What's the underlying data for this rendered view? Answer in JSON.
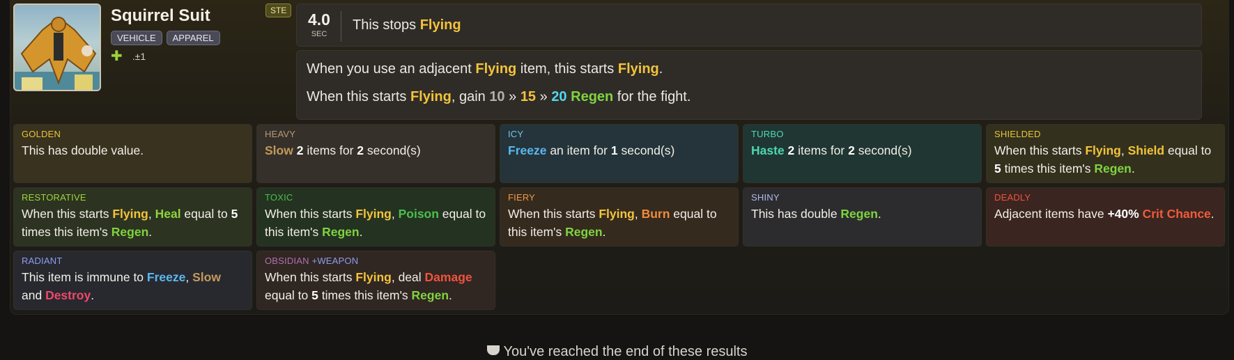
{
  "item": {
    "name": "Squirrel Suit",
    "tags": [
      "VEHICLE",
      "APPAREL"
    ],
    "enchant_count": ".±1",
    "badge": "STE"
  },
  "cooldown": {
    "value": "4.0",
    "unit": "SEC"
  },
  "abilities": {
    "top": {
      "pre": "This stops ",
      "kw": "Flying"
    },
    "line1": {
      "a": "When you use an adjacent ",
      "b": "Flying",
      "c": " item, this starts ",
      "d": "Flying",
      "e": "."
    },
    "line2": {
      "a": "When this starts ",
      "b": "Flying",
      "c": ", gain ",
      "v1": "10",
      "sep1": " » ",
      "v2": "15",
      "sep2": " » ",
      "v3": "20",
      "d": " ",
      "e": "Regen",
      "f": " for the fight."
    }
  },
  "enchantments": {
    "golden": {
      "title": "GOLDEN",
      "text": "This has double value."
    },
    "heavy": {
      "title": "HEAVY",
      "kw": "Slow",
      "a": " ",
      "n1": "2",
      "b": " items for ",
      "n2": "2",
      "c": " second(s)"
    },
    "icy": {
      "title": "ICY",
      "kw": "Freeze",
      "a": " an item for ",
      "n1": "1",
      "b": " second(s)"
    },
    "turbo": {
      "title": "TURBO",
      "kw": "Haste",
      "a": " ",
      "n1": "2",
      "b": " items for ",
      "n2": "2",
      "c": " second(s)"
    },
    "shielded": {
      "title": "SHIELDED",
      "a": "When this starts ",
      "fly": "Flying",
      "b": ", ",
      "kw": "Shield",
      "c": " equal to ",
      "n": "5",
      "d": " times this item's ",
      "regen": "Regen",
      "e": "."
    },
    "restorative": {
      "title": "RESTORATIVE",
      "a": "When this starts ",
      "fly": "Flying",
      "b": ", ",
      "kw": "Heal",
      "c": " equal to ",
      "n": "5",
      "d": " times this item's ",
      "regen": "Regen",
      "e": "."
    },
    "toxic": {
      "title": "TOXIC",
      "a": "When this starts ",
      "fly": "Flying",
      "b": ", ",
      "kw": "Poison",
      "c": " equal to this item's ",
      "regen": "Regen",
      "e": "."
    },
    "fiery": {
      "title": "FIERY",
      "a": "When this starts ",
      "fly": "Flying",
      "b": ", ",
      "kw": "Burn",
      "c": " equal to this item's ",
      "regen": "Regen",
      "e": "."
    },
    "shiny": {
      "title": "SHINY",
      "a": "This has double ",
      "regen": "Regen",
      "e": "."
    },
    "deadly": {
      "title": "DEADLY",
      "a": "Adjacent items have ",
      "n": "+40%",
      "b": " ",
      "kw": "Crit Chance",
      "e": "."
    },
    "radiant": {
      "title": "RADIANT",
      "a": "This item is immune to ",
      "kw1": "Freeze",
      "b": ", ",
      "kw2": "Slow",
      "c": " and ",
      "kw3": "Destroy",
      "e": "."
    },
    "obsidian": {
      "title": "OBSIDIAN",
      "tag": "+WEAPON",
      "a": "When this starts ",
      "fly": "Flying",
      "b": ", deal ",
      "kw": "Damage",
      "c": " equal to ",
      "n": "5",
      "d": " times this item's ",
      "regen": "Regen",
      "e": "."
    }
  },
  "footer": {
    "text": "You've reached the end of these results"
  },
  "icons": [
    "plus-icon",
    "trophy-icon"
  ],
  "colors": {
    "flying": "#f3c33b",
    "regen": "#7fd43f",
    "badge": "#4e4a1c"
  }
}
